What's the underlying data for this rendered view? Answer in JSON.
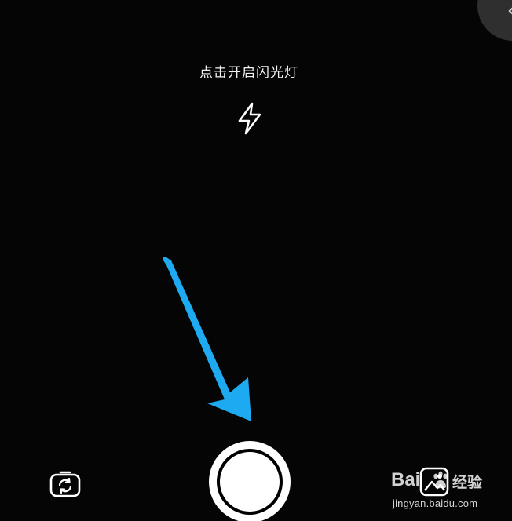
{
  "camera": {
    "flash_hint": "点击开启闪光灯",
    "icons": {
      "flash": "lightning-bolt-icon",
      "switch_camera": "camera-switch-icon",
      "gallery": "gallery-icon",
      "corner": "chevron-up-icon"
    }
  },
  "annotation": {
    "arrow_color": "#1eaaf1"
  },
  "watermark": {
    "brand_prefix": "Bai",
    "brand_suffix": "经验",
    "url": "jingyan.baidu.com"
  },
  "colors": {
    "background": "#050505",
    "foreground": "#ffffff"
  }
}
